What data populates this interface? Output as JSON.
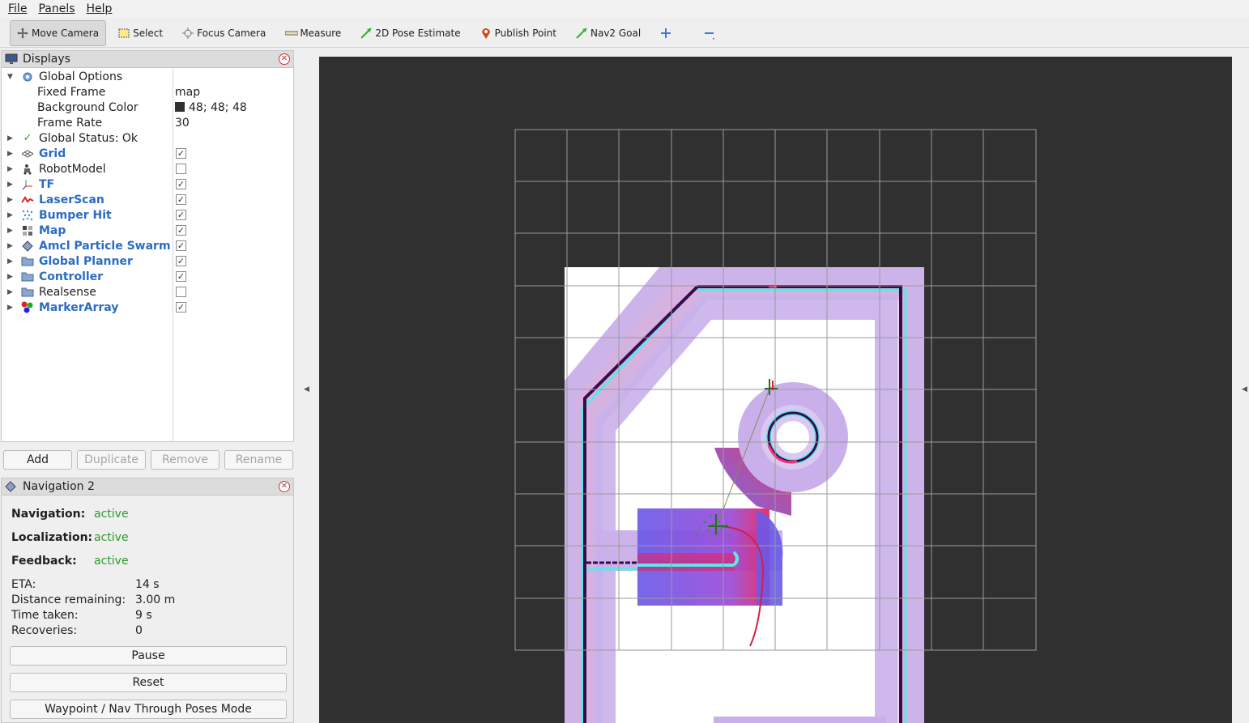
{
  "menubar": {
    "items": [
      {
        "label": "File"
      },
      {
        "label": "Panels"
      },
      {
        "label": "Help"
      }
    ]
  },
  "toolbar": {
    "tools": [
      {
        "label": "Move Camera",
        "icon": "move-camera-icon"
      },
      {
        "label": "Select",
        "icon": "select-icon"
      },
      {
        "label": "Focus Camera",
        "icon": "focus-camera-icon"
      },
      {
        "label": "Measure",
        "icon": "measure-icon"
      },
      {
        "label": "2D Pose Estimate",
        "icon": "pose-estimate-icon"
      },
      {
        "label": "Publish Point",
        "icon": "publish-point-icon"
      },
      {
        "label": "Nav2 Goal",
        "icon": "nav2-goal-icon"
      }
    ]
  },
  "displays": {
    "title": "Displays",
    "global_options": {
      "label": "Global Options",
      "fixed_frame_label": "Fixed Frame",
      "fixed_frame_value": "map",
      "background_color_label": "Background Color",
      "background_color_value": "48; 48; 48",
      "frame_rate_label": "Frame Rate",
      "frame_rate_value": "30"
    },
    "global_status": "Global Status: Ok",
    "items": [
      {
        "label": "Grid",
        "checked": "✓"
      },
      {
        "label": "RobotModel",
        "checked": ""
      },
      {
        "label": "TF",
        "checked": "✓"
      },
      {
        "label": "LaserScan",
        "checked": "✓"
      },
      {
        "label": "Bumper Hit",
        "checked": "✓"
      },
      {
        "label": "Map",
        "checked": "✓"
      },
      {
        "label": "Amcl Particle Swarm",
        "checked": "✓"
      },
      {
        "label": "Global Planner",
        "checked": "✓"
      },
      {
        "label": "Controller",
        "checked": "✓"
      },
      {
        "label": "Realsense",
        "checked": ""
      },
      {
        "label": "MarkerArray",
        "checked": "✓"
      }
    ],
    "buttons": {
      "add": "Add",
      "duplicate": "Duplicate",
      "remove": "Remove",
      "rename": "Rename"
    }
  },
  "navigation": {
    "title": "Navigation 2",
    "navigation_label": "Navigation:",
    "navigation_value": "active",
    "localization_label": "Localization:",
    "localization_value": "active",
    "feedback_label": "Feedback:",
    "feedback_value": "active",
    "eta_label": "ETA:",
    "eta_value": "14 s",
    "distance_label": "Distance remaining:",
    "distance_value": "3.00 m",
    "time_label": "Time taken:",
    "time_value": "9 s",
    "recoveries_label": "Recoveries:",
    "recoveries_value": "0",
    "pause_button": "Pause",
    "reset_button": "Reset",
    "waypoint_button": "Waypoint / Nav Through Poses Mode"
  },
  "viewport": {
    "background_color": "#303030",
    "grid_color": "#9a9a9a",
    "wall_color": "#3a0a4a",
    "costmap_color": "#c8a8e8",
    "inflation_color": "#5ae8e8",
    "path_color": "#d0204a"
  }
}
